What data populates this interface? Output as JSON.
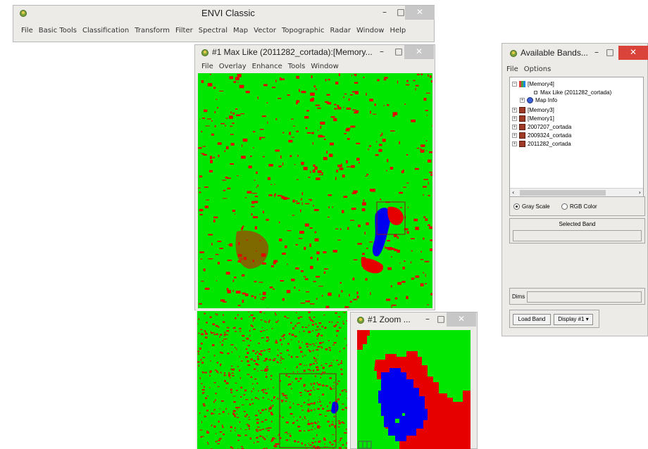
{
  "envi_main": {
    "title": "ENVI Classic",
    "menu": [
      "File",
      "Basic Tools",
      "Classification",
      "Transform",
      "Filter",
      "Spectral",
      "Map",
      "Vector",
      "Topographic",
      "Radar",
      "Window",
      "Help"
    ]
  },
  "image_window": {
    "title": "#1 Max Like (2011282_cortada):[Memory...",
    "menu": [
      "File",
      "Overlay",
      "Enhance",
      "Tools",
      "Window"
    ]
  },
  "zoom_window": {
    "title": "#1 Zoom ..."
  },
  "bands_window": {
    "title": "Available Bands...",
    "menu": [
      "File",
      "Options"
    ],
    "tree": {
      "memory4": "[Memory4]",
      "max_like": "Max Like (2011282_cortada)",
      "map_info": "Map Info",
      "memory3": "[Memory3]",
      "memory1": "[Memory1]",
      "f2007": "2007207_cortada",
      "f2009": "2009324_cortada",
      "f2011": "2011282_cortada"
    },
    "gray_scale": "Gray Scale",
    "rgb_color": "RGB Color",
    "selected_band_label": "Selected Band",
    "selected_band_value": "",
    "dims_label": "Dims",
    "dims_value": "",
    "load_band": "Load Band",
    "display_button": "Display #1"
  },
  "window_controls": {
    "minimize": "–",
    "maximize": "□",
    "close": "✕"
  },
  "colors": {
    "class_green": "#00e600",
    "class_red": "#e60000",
    "class_blue": "#0000f0",
    "close_red": "#d9433a"
  }
}
